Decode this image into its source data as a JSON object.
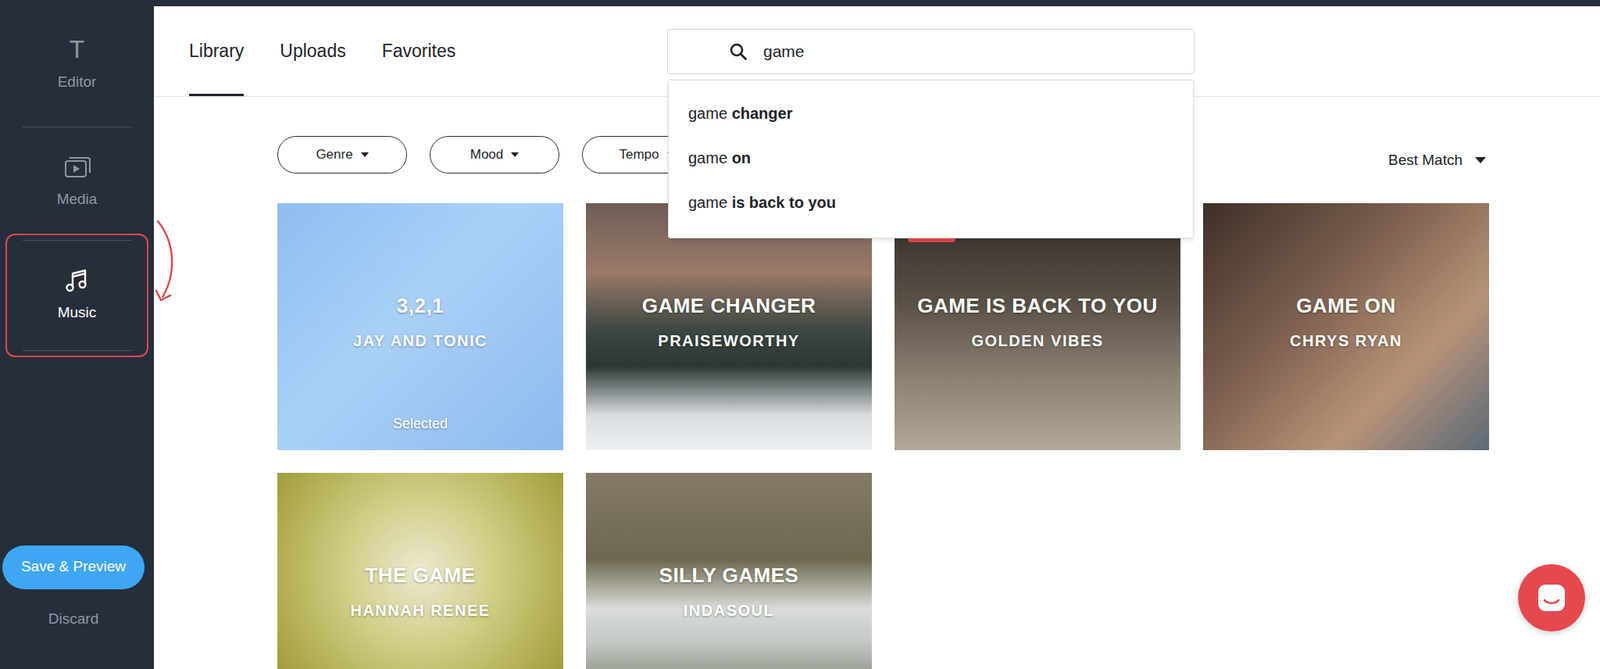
{
  "sidebar": {
    "items": [
      {
        "label": "Editor",
        "icon": "T",
        "selected": false
      },
      {
        "label": "Media",
        "selected": false
      },
      {
        "label": "Music",
        "selected": true
      }
    ],
    "save_button": "Save & Preview",
    "discard": "Discard"
  },
  "tabs": [
    {
      "label": "Library",
      "selected": true
    },
    {
      "label": "Uploads",
      "selected": false
    },
    {
      "label": "Favorites",
      "selected": false
    }
  ],
  "search": {
    "value": "game",
    "expanded": true,
    "suggestions": [
      {
        "typed": "game",
        "completion": "changer"
      },
      {
        "typed": "game",
        "completion": "on"
      },
      {
        "typed": "game",
        "completion": "is back to you"
      }
    ]
  },
  "filters": [
    {
      "label": "Genre"
    },
    {
      "label": "Mood"
    },
    {
      "label": "Tempo"
    }
  ],
  "sort": {
    "label": "Best Match"
  },
  "tracks": [
    {
      "title": "3,2,1",
      "artist": "JAY AND TONIC",
      "selected": true,
      "status": "Selected",
      "badge": false
    },
    {
      "title": "GAME CHANGER",
      "artist": "PRAISEWORTHY",
      "selected": false,
      "badge": false
    },
    {
      "title": "GAME IS BACK TO YOU",
      "artist": "GOLDEN VIBES",
      "selected": false,
      "badge": true
    },
    {
      "title": "GAME ON",
      "artist": "CHRYS RYAN",
      "selected": false,
      "badge": false
    },
    {
      "title": "THE GAME",
      "artist": "HANNAH RENEE",
      "selected": false,
      "badge": false
    },
    {
      "title": "SILLY GAMES",
      "artist": "INDASOUL",
      "selected": false,
      "badge": false
    }
  ]
}
